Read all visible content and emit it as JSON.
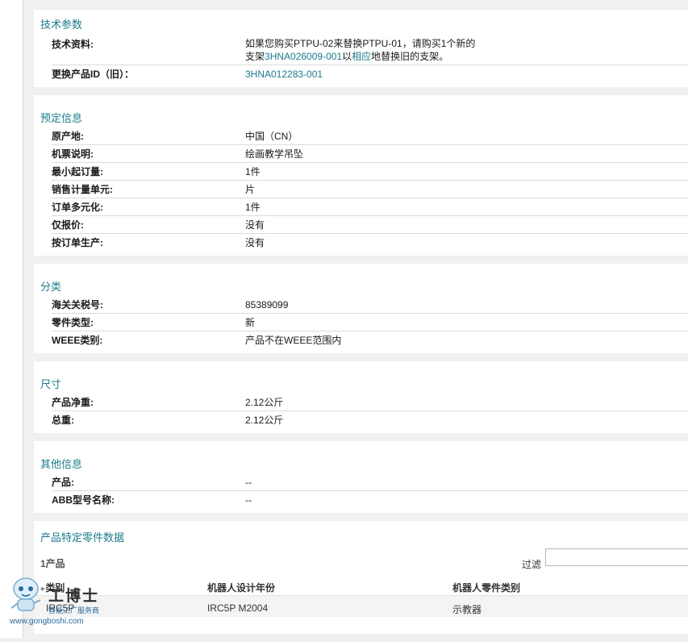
{
  "tech": {
    "title": "技术参数",
    "doc_label": "技术资料:",
    "doc_text_1": "如果您购买PTPU-02来替换PTPU-01，请购买1个新的",
    "doc_text_2a": "支架",
    "doc_link_1": "3HNA026009-001",
    "doc_text_2b": "以",
    "doc_link_2": "相应",
    "doc_text_2c": "地替换旧的支架。",
    "replace_label": "更换产品ID（旧）：",
    "replace_value": "3HNA012283-001"
  },
  "order": {
    "title": "预定信息",
    "rows": [
      {
        "k": "原产地:",
        "v": "中国（CN）"
      },
      {
        "k": "机票说明:",
        "v": "绘画教学吊坠"
      },
      {
        "k": "最小起订量:",
        "v": "1件"
      },
      {
        "k": "销售计量单元:",
        "v": "片"
      },
      {
        "k": "订单多元化:",
        "v": "1件"
      },
      {
        "k": "仅报价:",
        "v": "没有"
      },
      {
        "k": "按订单生产:",
        "v": "没有"
      }
    ]
  },
  "classification": {
    "title": "分类",
    "rows": [
      {
        "k": "海关关税号:",
        "v": "85389099"
      },
      {
        "k": "零件类型:",
        "v": "新"
      },
      {
        "k": "WEEE类别:",
        "v": "产品不在WEEE范围内"
      }
    ]
  },
  "dimensions": {
    "title": "尺寸",
    "rows": [
      {
        "k": "产品净重:",
        "v": "2.12公斤"
      },
      {
        "k": "总重:",
        "v": "2.12公斤"
      }
    ]
  },
  "other": {
    "title": "其他信息",
    "rows": [
      {
        "k": "产品:",
        "v": "--"
      },
      {
        "k": "ABB型号名称:",
        "v": "--"
      }
    ]
  },
  "parts": {
    "title": "产品特定零件数据",
    "count": "1产品",
    "filter_label": "过滤",
    "filter_value": "",
    "col1": "类别",
    "col2": "机器人设计年份",
    "col3": "机器人零件类别",
    "cell1": "IRC5P",
    "cell2": "IRC5P M2004",
    "cell3": "示教器"
  },
  "watermark": {
    "title": "工博士",
    "subtitle": "智能工厂服务商",
    "url": "www.gongboshi.com"
  }
}
